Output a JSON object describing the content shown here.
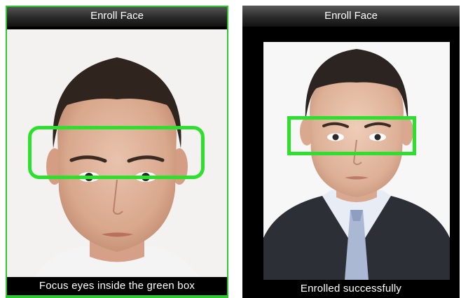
{
  "left_screen": {
    "title": "Enroll Face",
    "status": "Focus eyes inside the green box"
  },
  "right_screen": {
    "title": "Enroll Face",
    "status": "Enrolled successfully"
  },
  "colors": {
    "guide_box": "#2ee02e",
    "title_bar": "#2b2b2b",
    "status_bar": "#000000"
  }
}
